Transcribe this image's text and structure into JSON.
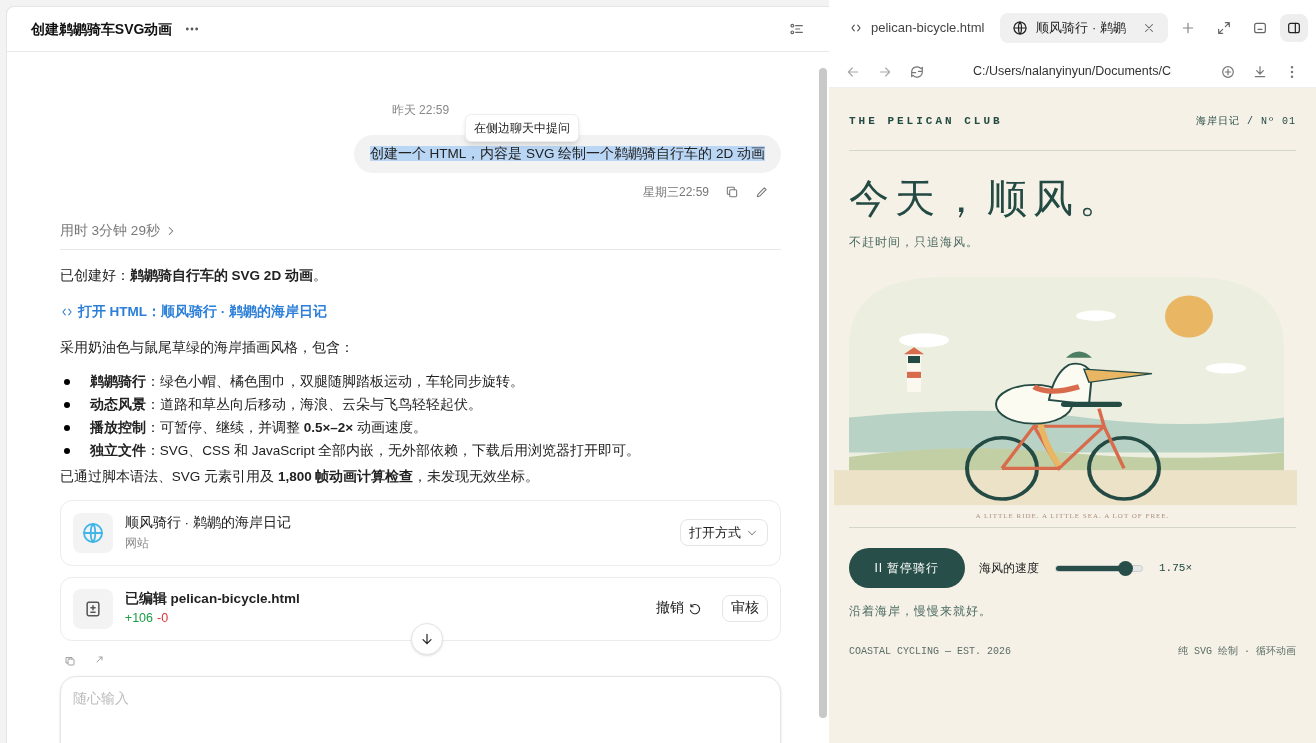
{
  "chat": {
    "title": "创建鹈鹕骑车SVG动画",
    "date_label": "昨天 22:59",
    "tooltip": "在侧边聊天中提问",
    "user_message": {
      "text": "创建一个 HTML，内容是 SVG 绘制一个鹈鹕骑自行车的 2D 动画",
      "selected": true
    },
    "message_time": "星期三22:59",
    "thinking": "用时 3分钟 29秒",
    "intro": "已创建好：**鹈鹕骑自行车的 SVG 2D 动画**。",
    "link": "打开 HTML：顺风骑行 · 鹈鹕的海岸日记",
    "lead": "采用奶油色与鼠尾草绿的海岸插画风格，包含：",
    "bullets": [
      "**鹈鹕骑行**：绿色小帽、橘色围巾，双腿随脚踏板运动，车轮同步旋转。",
      "**动态风景**：道路和草丛向后移动，海浪、云朵与飞鸟轻轻起伏。",
      "**播放控制**：可暂停、继续，并调整 **0.5×–2×** 动画速度。",
      "**独立文件**：SVG、CSS 和 JavaScript 全部内嵌，无外部依赖，下载后用浏览器打开即可。"
    ],
    "conclusion": "已通过脚本语法、SVG 元素引用及 **1,800 帧动画计算检查**，未发现无效坐标。",
    "site_card": {
      "title": "顺风骑行 · 鹈鹕的海岸日记",
      "subtitle": "网站",
      "button": "打开方式"
    },
    "edit_card": {
      "title": "已编辑 pelican-bicycle.html",
      "added": "+106",
      "removed": "-0",
      "undo": "撤销",
      "review": "审核"
    },
    "input": {
      "placeholder": "随心输入"
    }
  },
  "preview": {
    "tabs": [
      {
        "kind": "code",
        "label": "pelican-bicycle.html",
        "selected": false
      },
      {
        "kind": "web",
        "label": "顺风骑行 · 鹈鹕",
        "selected": true
      }
    ],
    "address": "C:/Users/nalanyinyun/Documents/C",
    "page": {
      "brand": "THE PELICAN CLUB",
      "issue": "海岸日记 / Nº 01",
      "headline": "今天，顺风。",
      "subtitle": "不赶时间，只追海风。",
      "caption": "A LITTLE RIDE. A LITTLE SEA. A LOT OF FREE.",
      "pause_button": "II 暂停骑行",
      "speed_label": "海风的速度",
      "speed": {
        "level": 0.8
      },
      "speed_reading": "1.75×",
      "note": "沿着海岸，慢慢来就好。",
      "footer_left": "COASTAL CYCLING — EST. 2026",
      "footer_right": "纯 SVG 绘制 · 循环动画"
    }
  }
}
